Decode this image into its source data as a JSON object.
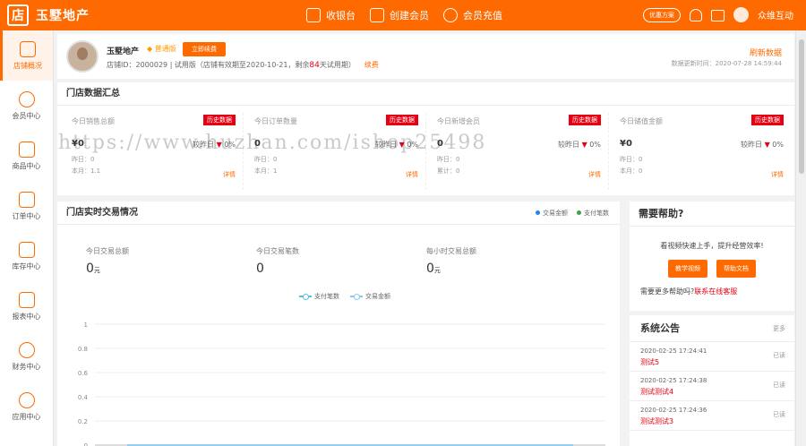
{
  "topbar": {
    "logo_char": "店",
    "brand": "玉墅地产",
    "nav": [
      {
        "label": "收银台",
        "icon": "cashier-icon"
      },
      {
        "label": "创建会员",
        "icon": "create-member-icon"
      },
      {
        "label": "会员充值",
        "icon": "recharge-icon"
      }
    ],
    "promo_label": "优惠方案",
    "user_name": "众维互动",
    "accent_color": "#ff6a00"
  },
  "sidebar": {
    "items": [
      {
        "label": "店铺概况",
        "icon": "home-icon",
        "active": true
      },
      {
        "label": "会员中心",
        "icon": "member-icon"
      },
      {
        "label": "商品中心",
        "icon": "goods-icon"
      },
      {
        "label": "订单中心",
        "icon": "order-icon"
      },
      {
        "label": "库存中心",
        "icon": "inventory-icon"
      },
      {
        "label": "报表中心",
        "icon": "report-icon"
      },
      {
        "label": "财务中心",
        "icon": "finance-icon"
      },
      {
        "label": "应用中心",
        "icon": "app-icon"
      }
    ]
  },
  "profile": {
    "name": "玉墅地产",
    "badge": "普通版",
    "renew_button": "立即续费",
    "info_prefix": "店铺ID：2000029 | 试用版（店铺有效期至2020-10-21，剩余",
    "days_left": "84",
    "info_suffix": "天试用期）",
    "renew_link": "续费",
    "refresh": "刷新数据",
    "update_time": "数据更新时间：2020-07-28 14:59:44"
  },
  "summary": {
    "title": "门店数据汇总",
    "history_label": "历史数据",
    "detail_label": "详情",
    "cards": [
      {
        "label": "今日销售总额",
        "value": "¥0",
        "compare": "较昨日",
        "pct": "0%",
        "meta1": "昨日：0",
        "meta2": "本月：1.1"
      },
      {
        "label": "今日订单数量",
        "value": "0",
        "compare": "较昨日",
        "pct": "0%",
        "meta1": "昨日：0",
        "meta2": "本月：1"
      },
      {
        "label": "今日新增会员",
        "value": "0",
        "compare": "较昨日",
        "pct": "0%",
        "meta1": "昨日：0",
        "meta2": "累计：0"
      },
      {
        "label": "今日储值金额",
        "value": "¥0",
        "compare": "较昨日",
        "pct": "0%",
        "meta1": "昨日：0",
        "meta2": "本月：0"
      }
    ]
  },
  "realtime": {
    "title": "门店实时交易情况",
    "legend_top": [
      {
        "label": "交易金额",
        "color": "#1e88e5"
      },
      {
        "label": "支付笔数",
        "color": "#43a047"
      }
    ],
    "stats": [
      {
        "label": "今日交易总额",
        "value": "0",
        "unit": "元"
      },
      {
        "label": "今日交易笔数",
        "value": "0"
      },
      {
        "label": "每小时交易总额",
        "value": "0",
        "unit": "元"
      }
    ]
  },
  "chart_data": {
    "type": "line",
    "series": [
      {
        "name": "支付笔数",
        "color": "#5bc0de"
      },
      {
        "name": "交易金额",
        "color": "#8ec8f0"
      }
    ],
    "y_ticks": [
      "1",
      "0.8",
      "0.6",
      "0.4",
      "0.2",
      "0"
    ],
    "ylim": [
      0,
      1
    ]
  },
  "help": {
    "title": "需要帮助?",
    "text": "看视频快速上手，提升经营效率!",
    "btn_video": "教学视频",
    "btn_doc": "帮助文档",
    "more_prefix": "需要更多帮助吗?",
    "more_link": "联系在线客服"
  },
  "notices": {
    "title": "系统公告",
    "more": "更多",
    "items": [
      {
        "time": "2020-02-25 17:24:41",
        "title": "测试5",
        "status": "已读"
      },
      {
        "time": "2020-02-25 17:24:38",
        "title": "测试测试4",
        "status": "已读"
      },
      {
        "time": "2020-02-25 17:24:36",
        "title": "测试测试3",
        "status": "已读"
      }
    ]
  },
  "watermark": "https://www.huzhan.com/ishop25498"
}
